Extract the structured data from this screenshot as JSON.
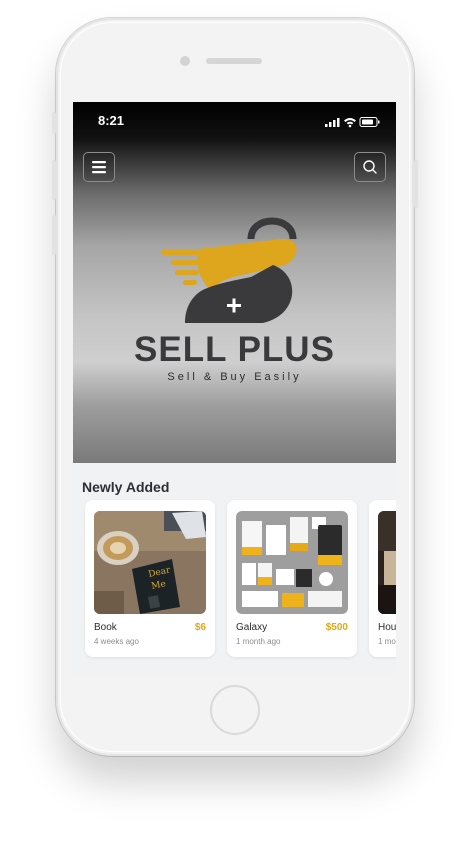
{
  "status_bar": {
    "time": "8:21"
  },
  "header": {
    "menu_icon": "hamburger-menu-icon",
    "search_icon": "search-icon"
  },
  "logo": {
    "name": "SELL PLUS",
    "tagline": "Sell & Buy Easily",
    "colors": {
      "gold": "#dda61c",
      "dark": "#3a3a3d"
    }
  },
  "section": {
    "title": "Newly Added"
  },
  "cards": [
    {
      "name": "Book",
      "price": "$6",
      "date": "4 weeks ago"
    },
    {
      "name": "Galaxy",
      "price": "$500",
      "date": "1 month ago"
    },
    {
      "name": "Hou",
      "price": "",
      "date": "1 mo"
    }
  ],
  "colors": {
    "accent": "#e0a81a",
    "screen_bg": "#f1f2f4"
  }
}
